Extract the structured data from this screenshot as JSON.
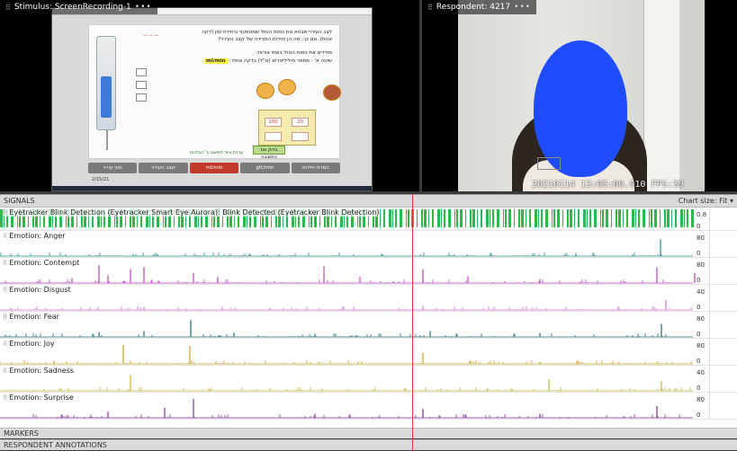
{
  "stimulus": {
    "title": "Stimulus: ScreenRecording-1",
    "menu": "•••",
    "question_line1": "לצב העירוי מבטא את כמות הנוזל שמטפטף ביחידת זמן (דקה",
    "question_line2": "אחת). אם כך, מה הן יחידות המדידה של קצב העירוי?",
    "instruction_line1": "מודדים את כמות הנוזל בשתי צורות:",
    "instruction_line2_prefix": "שיטה א' - מספר מיליליטרים (מ\"ל) בדקה אחת -",
    "instruction_highlight": "ml/min",
    "grid_values": [
      "100",
      "20"
    ],
    "green_button": "בדוק את התשובה",
    "footer_note": "ערכת ציוד לחישוב ב' הפלגות",
    "nav_tabs": [
      {
        "label": "סוף עירוי",
        "active": false
      },
      {
        "label": "קצב העירוי",
        "active": false
      },
      {
        "label": "ml/min",
        "active": true
      },
      {
        "label": "gtt/min",
        "active": false
      },
      {
        "label": "המרת יחידות",
        "active": false
      }
    ],
    "small_text": "2/15/21"
  },
  "respondent": {
    "title": "Respondent: 4217",
    "menu": "•••",
    "timestamp": "20210114 13:05:00.910 FPS:30"
  },
  "signals": {
    "header": "SIGNALS",
    "chart_size_label": "Chart size:",
    "chart_size_value": "Fit ▾",
    "tracks": [
      {
        "label": "Eyetracker Blink Detection (Eyetracker Smart Eye Aurora): Blink Detected (Eyetracker Blink Detection)",
        "max": "0.8",
        "min": "0",
        "color": "#2db84d",
        "kind": "blink"
      },
      {
        "label": "Emotion: Anger",
        "max": "80",
        "min": "0",
        "color": "#2a8a86",
        "kind": "emotion"
      },
      {
        "label": "Emotion: Contempt",
        "max": "80",
        "min": "0",
        "color": "#b247b5",
        "kind": "emotion"
      },
      {
        "label": "Emotion: Disgust",
        "max": "40",
        "min": "0",
        "color": "#d077cf",
        "kind": "emotion"
      },
      {
        "label": "Emotion: Fear",
        "max": "80",
        "min": "0",
        "color": "#1f6e6a",
        "kind": "emotion"
      },
      {
        "label": "Emotion: Joy",
        "max": "80",
        "min": "0",
        "color": "#c9a227",
        "kind": "emotion"
      },
      {
        "label": "Emotion: Sadness",
        "max": "40",
        "min": "0",
        "color": "#c9b13a",
        "kind": "emotion"
      },
      {
        "label": "Emotion: Surprise",
        "max": "80",
        "min": "0",
        "color": "#7b2f8f",
        "kind": "emotion"
      }
    ]
  },
  "markers": {
    "label": "MARKERS"
  },
  "annotations": {
    "label": "RESPONDENT ANNOTATIONS"
  }
}
